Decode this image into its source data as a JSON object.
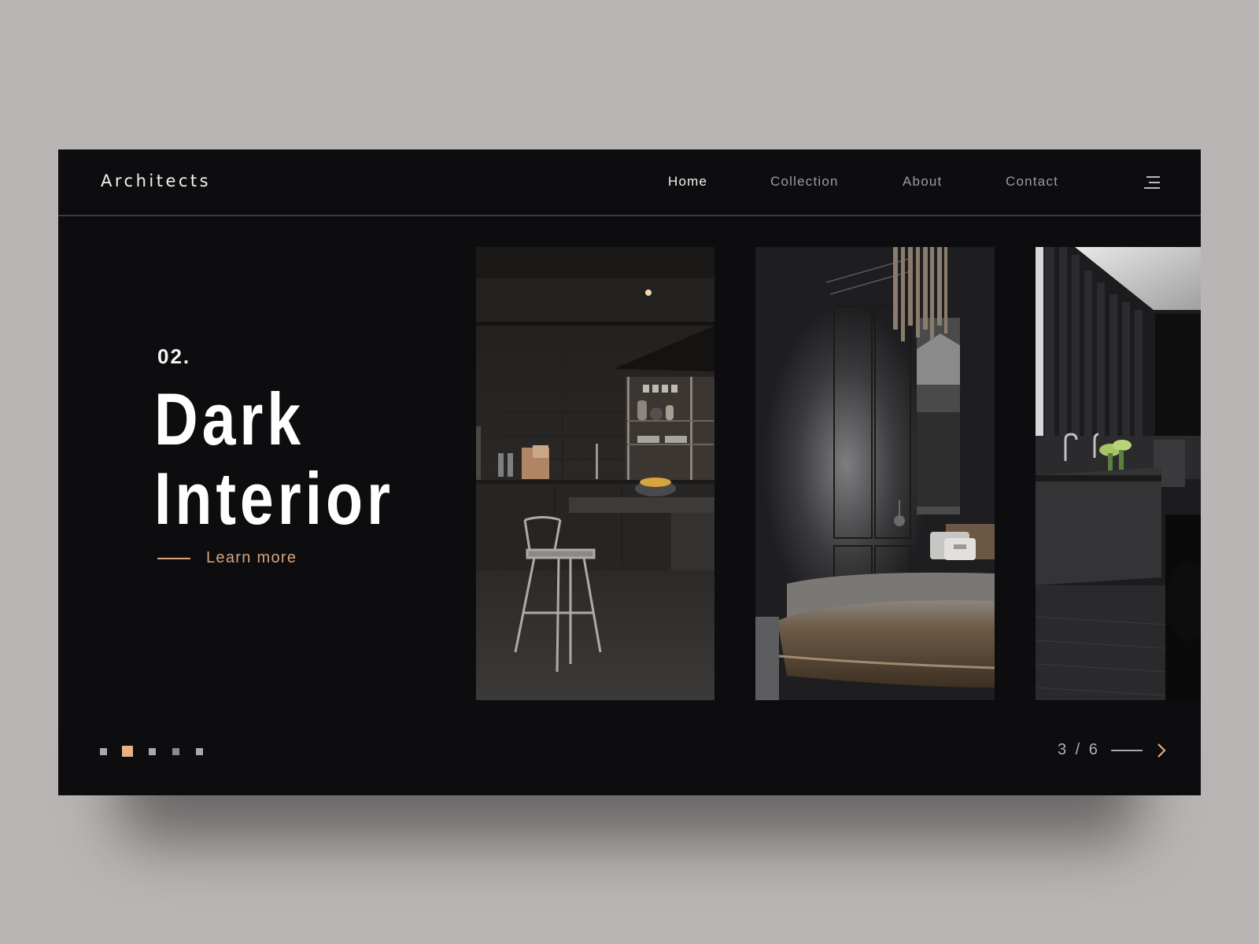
{
  "header": {
    "logo": "Architects",
    "nav": [
      {
        "label": "Home",
        "active": true
      },
      {
        "label": "Collection",
        "active": false
      },
      {
        "label": "About",
        "active": false
      },
      {
        "label": "Contact",
        "active": false
      }
    ],
    "menu_icon": "hamburger-menu-icon"
  },
  "hero": {
    "index": "02.",
    "title_line1": "Dark",
    "title_line2": "Interior",
    "cta_label": "Learn more"
  },
  "gallery": {
    "images": [
      {
        "subject": "dark kitchen with metal bar stool and open shelving"
      },
      {
        "subject": "dark bedroom with paneled walls, chandelier and brown bedding"
      },
      {
        "subject": "dark bathroom with stone vanity, faucets and green flowers"
      }
    ]
  },
  "slider": {
    "dots_total": 5,
    "active_dot": 2,
    "current": 3,
    "total": 6,
    "counter_text": "3 / 6",
    "next_icon": "chevron-right-icon"
  },
  "colors": {
    "background": "#bab5b5",
    "frame": "#0d0d10",
    "accent": "#d9a47c",
    "active_dot": "#e8b084"
  }
}
